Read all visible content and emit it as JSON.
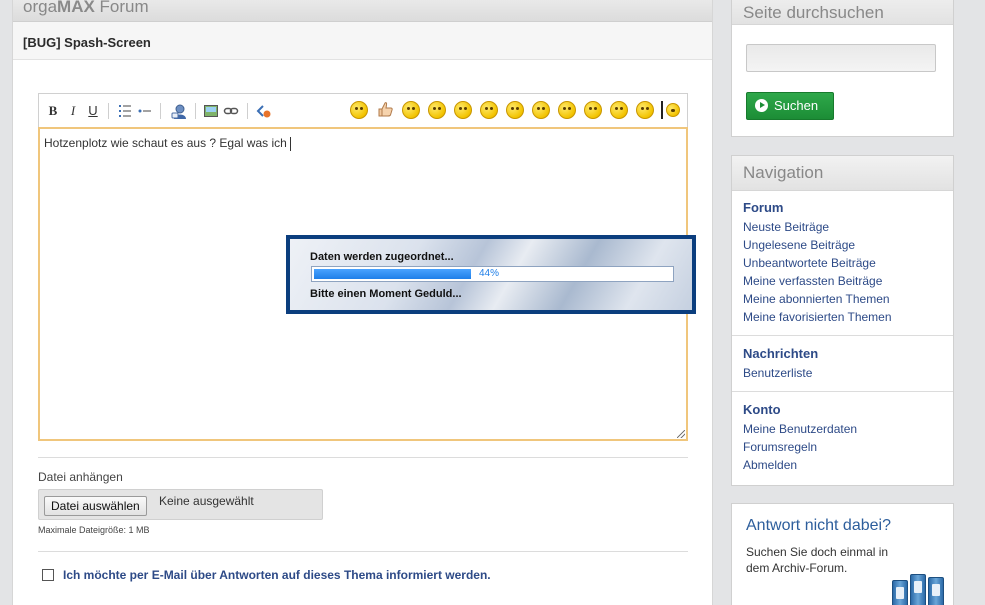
{
  "header": {
    "brand_prefix": "orga",
    "brand_bold": "MAX",
    "brand_suffix": " Forum"
  },
  "thread": {
    "title": "[BUG] Spash-Screen"
  },
  "editor": {
    "toolbar": {
      "bold": "B",
      "italic": "I",
      "underline": "U",
      "icons": [
        "bold-icon",
        "italic-icon",
        "underline-icon",
        "ordered-list-icon",
        "unordered-list-icon",
        "user-quote-icon",
        "image-icon",
        "link-icon",
        "code-icon"
      ],
      "smileys": [
        "smile",
        "thumbs-up",
        "wink",
        "sad",
        "grin",
        "tongue",
        "angry",
        "cool",
        "confused",
        "surprised",
        "worried",
        "neutral",
        "more-smileys"
      ]
    },
    "text": "Hotzenplotz wie schaut es aus ? Egal was ich"
  },
  "splash": {
    "status": "Daten werden zugeordnet...",
    "progress": 0.44,
    "progress_label": "44%",
    "wait": "Bitte einen Moment Geduld..."
  },
  "attachment": {
    "label": "Datei anhängen",
    "button": "Datei auswählen",
    "none": "Keine ausgewählt",
    "max_size": "Maximale Dateigröße: 1 MB"
  },
  "notify": {
    "label": "Ich möchte per E-Mail über Antworten auf dieses Thema informiert werden."
  },
  "sidebar": {
    "search": {
      "title": "Seite durchsuchen",
      "button": "Suchen"
    },
    "navigation": {
      "title": "Navigation",
      "forum": {
        "heading": "Forum",
        "links": [
          "Neuste Beiträge",
          "Ungelesene Beiträge",
          "Unbeantwortete Beiträge",
          "Meine verfassten Beiträge",
          "Meine abonnierten Themen",
          "Meine favorisierten Themen"
        ]
      },
      "messages": {
        "heading": "Nachrichten",
        "links": [
          "Benutzerliste"
        ]
      },
      "account": {
        "heading": "Konto",
        "links": [
          "Meine Benutzerdaten",
          "Forumsregeln",
          "Abmelden"
        ]
      }
    },
    "archiv": {
      "title": "Antwort nicht dabei?",
      "text": "Suchen Sie doch einmal in dem Archiv-Forum."
    }
  }
}
